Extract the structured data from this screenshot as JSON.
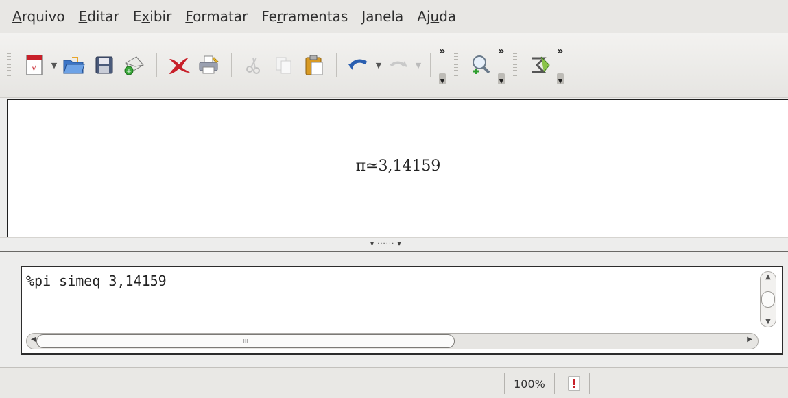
{
  "menu": [
    {
      "pre": "",
      "key": "A",
      "post": "rquivo"
    },
    {
      "pre": "",
      "key": "E",
      "post": "ditar"
    },
    {
      "pre": "E",
      "key": "x",
      "post": "ibir"
    },
    {
      "pre": "",
      "key": "F",
      "post": "ormatar"
    },
    {
      "pre": "Fe",
      "key": "r",
      "post": "ramentas"
    },
    {
      "pre": "",
      "key": "J",
      "post": "anela"
    },
    {
      "pre": "Aj",
      "key": "u",
      "post": "da"
    }
  ],
  "toolbar": {
    "icons": [
      "formula-document-icon",
      "open-folder-icon",
      "save-icon",
      "send-mail-icon",
      "pdf-export-icon",
      "print-icon",
      "cut-icon",
      "copy-icon",
      "paste-icon",
      "undo-icon",
      "redo-icon",
      "zoom-icon",
      "symbols-icon"
    ]
  },
  "preview": {
    "formula": "π≃3,14159"
  },
  "splitter": {
    "grip": "▾ ······ ▾"
  },
  "commands": {
    "text": "%pi simeq 3,14159",
    "hscroll_grip": "III"
  },
  "status": {
    "zoom": "100%"
  },
  "colors": {
    "accent_red": "#c8202a",
    "folder_blue": "#3b74c6",
    "paste_orange": "#d89a24"
  }
}
